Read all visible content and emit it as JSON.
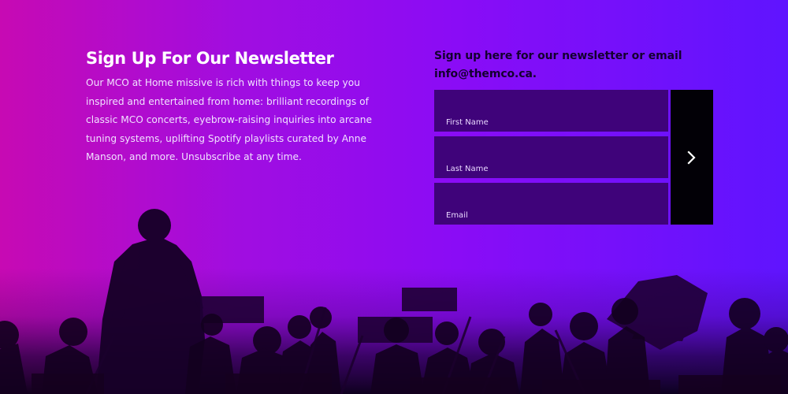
{
  "newsletter": {
    "heading": "Sign Up For Our Newsletter",
    "body_lines": [
      "Our MCO at Home missive is rich with things to keep you",
      "inspired and entertained from home: brilliant recordings of",
      "classic MCO concerts, eyebrow-raising inquiries into arcane",
      "tuning systems, uplifting Spotify playlists curated by Anne",
      "Manson, and more. Unsubscribe at any time."
    ]
  },
  "form": {
    "title_lines": [
      "Sign up here for our newsletter or email",
      "info@themco.ca."
    ],
    "fields": {
      "first_name_placeholder": "First Name",
      "last_name_placeholder": "Last Name",
      "email_placeholder": "Email"
    },
    "submit_icon": "chevron-right-icon"
  },
  "theme": {
    "gradient_left": "#c70ab3",
    "gradient_mid": "#8a0cf6",
    "gradient_right": "#5f14ff",
    "field_background": "#3f037a",
    "submit_background": "#020006",
    "heading_color": "#ffffff",
    "form_title_color": "#14002f"
  },
  "background_image": {
    "subject": "orchestra-silhouette"
  }
}
